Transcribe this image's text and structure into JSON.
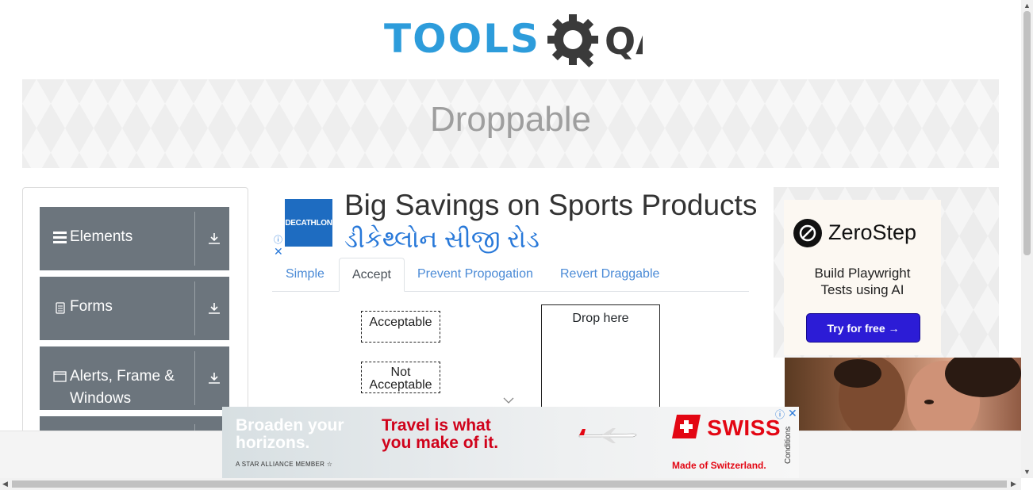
{
  "header": {
    "logo_text_left": "TOOLS",
    "logo_text_right": "QA"
  },
  "banner": {
    "title": "Droppable"
  },
  "sidebar": {
    "groups": [
      {
        "label": "Elements",
        "icon": "hamburger-icon"
      },
      {
        "label": "Forms",
        "icon": "document-icon"
      },
      {
        "label": "Alerts, Frame &",
        "label2": "Windows",
        "icon": "window-icon"
      }
    ]
  },
  "ad_top": {
    "brand": "DECATHLON",
    "headline": "Big Savings on Sports Products",
    "subline": "ડીકેથ્લોન સીજી રોડ"
  },
  "tabs": [
    {
      "label": "Simple",
      "active": false
    },
    {
      "label": "Accept",
      "active": true
    },
    {
      "label": "Prevent Propogation",
      "active": false
    },
    {
      "label": "Revert Draggable",
      "active": false
    }
  ],
  "accept": {
    "acceptable": "Acceptable",
    "not_acceptable_1": "Not",
    "not_acceptable_2": "Acceptable",
    "drop_target": "Drop here"
  },
  "ad_right": {
    "brand": "ZeroStep",
    "desc_1": "Build Playwright",
    "desc_2": "Tests using AI",
    "cta": "Try for free →"
  },
  "ad_bottom": {
    "left_1": "Broaden your",
    "left_2": "horizons.",
    "star": "A STAR ALLIANCE MEMBER",
    "mid_1": "Travel is what",
    "mid_2": "you make of it.",
    "brand": "SWISS",
    "tagline": "Made of Switzerland.",
    "conditions": "Conditions"
  },
  "colors": {
    "accent": "#2d9cdb",
    "sidebar_bg": "#6c757d",
    "tab_link": "#4a8ad6",
    "swiss_red": "#e30613"
  }
}
